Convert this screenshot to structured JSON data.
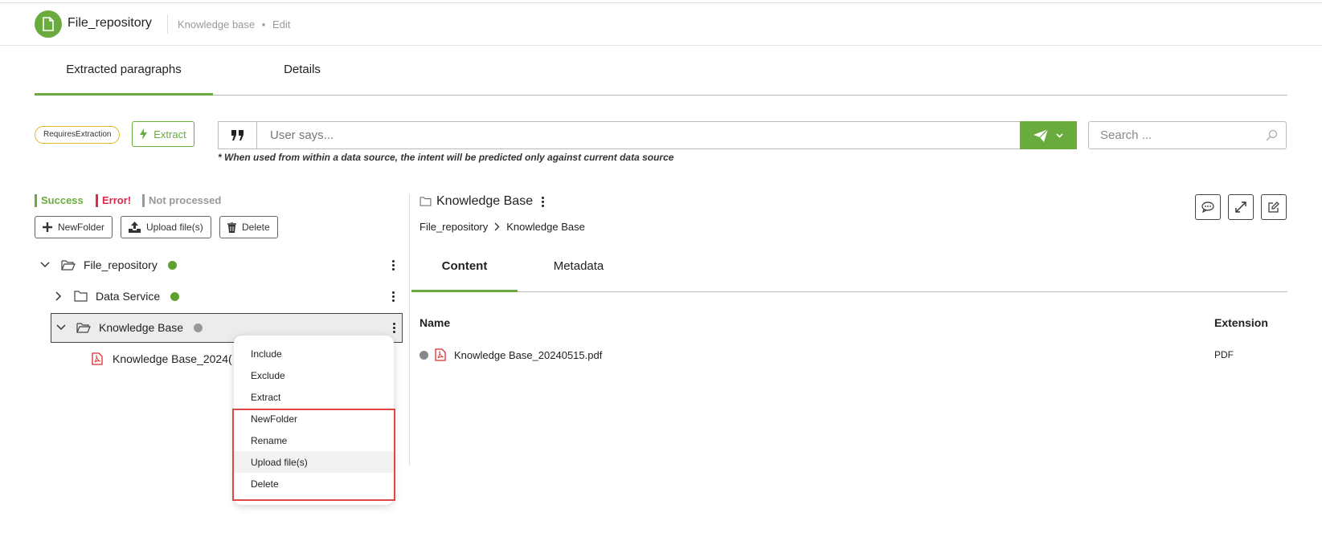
{
  "header": {
    "app_title": "File_repository",
    "breadcrumb_section": "Knowledge base",
    "breadcrumb_separator": "•",
    "breadcrumb_mode": "Edit"
  },
  "main_tabs": [
    {
      "label": "Extracted paragraphs",
      "active": true
    },
    {
      "label": "Details",
      "active": false
    }
  ],
  "toolbar": {
    "status_badge": "RequiresExtraction",
    "extract_label": "Extract",
    "user_says_placeholder": "User says...",
    "hint": "* When used from within a data source, the intent will be predicted only against current data source",
    "search_placeholder": "Search ..."
  },
  "legend": {
    "success": "Success",
    "error": "Error!",
    "not_processed": "Not processed"
  },
  "tree_actions": {
    "new_folder": "NewFolder",
    "upload": "Upload file(s)",
    "delete": "Delete"
  },
  "tree": {
    "root": "File_repository",
    "data_service": "Data Service",
    "knowledge_base": "Knowledge Base",
    "file_truncated": "Knowledge Base_2024("
  },
  "context_menu": {
    "items": [
      "Include",
      "Exclude",
      "Extract",
      "NewFolder",
      "Rename",
      "Upload file(s)",
      "Delete"
    ],
    "highlighted": "Upload file(s)"
  },
  "panel": {
    "title": "Knowledge Base",
    "breadcrumb_root": "File_repository",
    "breadcrumb_current": "Knowledge Base",
    "tabs": [
      {
        "label": "Content",
        "active": true
      },
      {
        "label": "Metadata",
        "active": false
      }
    ],
    "columns": {
      "name": "Name",
      "extension": "Extension"
    },
    "files": [
      {
        "name": "Knowledge Base_20240515.pdf",
        "extension": "PDF",
        "status": "not-processed"
      }
    ]
  },
  "colors": {
    "accent": "#6aab3e",
    "error": "#e0284a",
    "not_processed": "#999999",
    "badge_border": "#e6b32a",
    "highlight_box": "#e04848"
  },
  "icons": [
    "document-icon",
    "lightning-icon",
    "quote-icon",
    "send-icon",
    "chevron-down-icon",
    "search-icon",
    "plus-icon",
    "upload-icon",
    "trash-icon",
    "folder-open-icon",
    "folder-icon",
    "chevron-right-icon",
    "pdf-icon",
    "kebab-menu-icon",
    "comment-icon",
    "expand-icon",
    "edit-icon"
  ]
}
